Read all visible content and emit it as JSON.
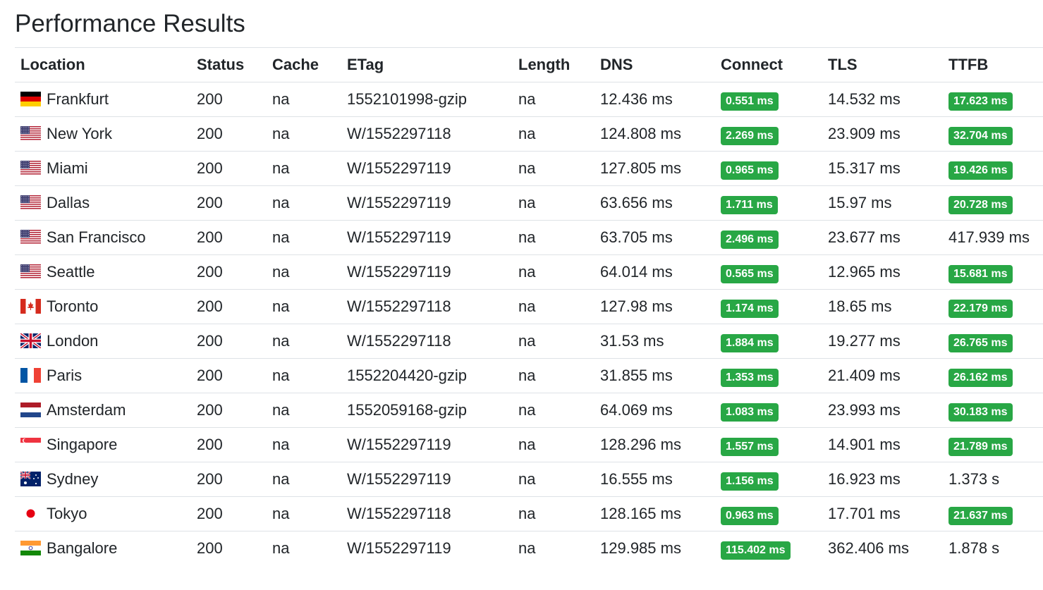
{
  "title": "Performance Results",
  "columns": [
    "Location",
    "Status",
    "Cache",
    "ETag",
    "Length",
    "DNS",
    "Connect",
    "TLS",
    "TTFB"
  ],
  "rows": [
    {
      "flag": "germany-flag-icon",
      "location": "Frankfurt",
      "status": "200",
      "cache": "na",
      "etag": "1552101998-gzip",
      "length": "na",
      "dns": "12.436 ms",
      "connect": "0.551 ms",
      "tls": "14.532 ms",
      "ttfb": "17.623 ms",
      "ttfb_badge": true
    },
    {
      "flag": "usa-flag-icon",
      "location": "New York",
      "status": "200",
      "cache": "na",
      "etag": "W/1552297118",
      "length": "na",
      "dns": "124.808 ms",
      "connect": "2.269 ms",
      "tls": "23.909 ms",
      "ttfb": "32.704 ms",
      "ttfb_badge": true
    },
    {
      "flag": "usa-flag-icon",
      "location": "Miami",
      "status": "200",
      "cache": "na",
      "etag": "W/1552297119",
      "length": "na",
      "dns": "127.805 ms",
      "connect": "0.965 ms",
      "tls": "15.317 ms",
      "ttfb": "19.426 ms",
      "ttfb_badge": true
    },
    {
      "flag": "usa-flag-icon",
      "location": "Dallas",
      "status": "200",
      "cache": "na",
      "etag": "W/1552297119",
      "length": "na",
      "dns": "63.656 ms",
      "connect": "1.711 ms",
      "tls": "15.97 ms",
      "ttfb": "20.728 ms",
      "ttfb_badge": true
    },
    {
      "flag": "usa-flag-icon",
      "location": "San Francisco",
      "status": "200",
      "cache": "na",
      "etag": "W/1552297119",
      "length": "na",
      "dns": "63.705 ms",
      "connect": "2.496 ms",
      "tls": "23.677 ms",
      "ttfb": "417.939 ms",
      "ttfb_badge": false
    },
    {
      "flag": "usa-flag-icon",
      "location": "Seattle",
      "status": "200",
      "cache": "na",
      "etag": "W/1552297119",
      "length": "na",
      "dns": "64.014 ms",
      "connect": "0.565 ms",
      "tls": "12.965 ms",
      "ttfb": "15.681 ms",
      "ttfb_badge": true
    },
    {
      "flag": "canada-flag-icon",
      "location": "Toronto",
      "status": "200",
      "cache": "na",
      "etag": "W/1552297118",
      "length": "na",
      "dns": "127.98 ms",
      "connect": "1.174 ms",
      "tls": "18.65 ms",
      "ttfb": "22.179 ms",
      "ttfb_badge": true
    },
    {
      "flag": "uk-flag-icon",
      "location": "London",
      "status": "200",
      "cache": "na",
      "etag": "W/1552297118",
      "length": "na",
      "dns": "31.53 ms",
      "connect": "1.884 ms",
      "tls": "19.277 ms",
      "ttfb": "26.765 ms",
      "ttfb_badge": true
    },
    {
      "flag": "france-flag-icon",
      "location": "Paris",
      "status": "200",
      "cache": "na",
      "etag": "1552204420-gzip",
      "length": "na",
      "dns": "31.855 ms",
      "connect": "1.353 ms",
      "tls": "21.409 ms",
      "ttfb": "26.162 ms",
      "ttfb_badge": true
    },
    {
      "flag": "netherlands-flag-icon",
      "location": "Amsterdam",
      "status": "200",
      "cache": "na",
      "etag": "1552059168-gzip",
      "length": "na",
      "dns": "64.069 ms",
      "connect": "1.083 ms",
      "tls": "23.993 ms",
      "ttfb": "30.183 ms",
      "ttfb_badge": true
    },
    {
      "flag": "singapore-flag-icon",
      "location": "Singapore",
      "status": "200",
      "cache": "na",
      "etag": "W/1552297119",
      "length": "na",
      "dns": "128.296 ms",
      "connect": "1.557 ms",
      "tls": "14.901 ms",
      "ttfb": "21.789 ms",
      "ttfb_badge": true
    },
    {
      "flag": "australia-flag-icon",
      "location": "Sydney",
      "status": "200",
      "cache": "na",
      "etag": "W/1552297119",
      "length": "na",
      "dns": "16.555 ms",
      "connect": "1.156 ms",
      "tls": "16.923 ms",
      "ttfb": "1.373 s",
      "ttfb_badge": false
    },
    {
      "flag": "japan-flag-icon",
      "location": "Tokyo",
      "status": "200",
      "cache": "na",
      "etag": "W/1552297118",
      "length": "na",
      "dns": "128.165 ms",
      "connect": "0.963 ms",
      "tls": "17.701 ms",
      "ttfb": "21.637 ms",
      "ttfb_badge": true
    },
    {
      "flag": "india-flag-icon",
      "location": "Bangalore",
      "status": "200",
      "cache": "na",
      "etag": "W/1552297119",
      "length": "na",
      "dns": "129.985 ms",
      "connect": "115.402 ms",
      "tls": "362.406 ms",
      "ttfb": "1.878 s",
      "ttfb_badge": false
    }
  ],
  "colors": {
    "badge_success": "#28a745",
    "text": "#212529",
    "border": "#dee2e6"
  }
}
